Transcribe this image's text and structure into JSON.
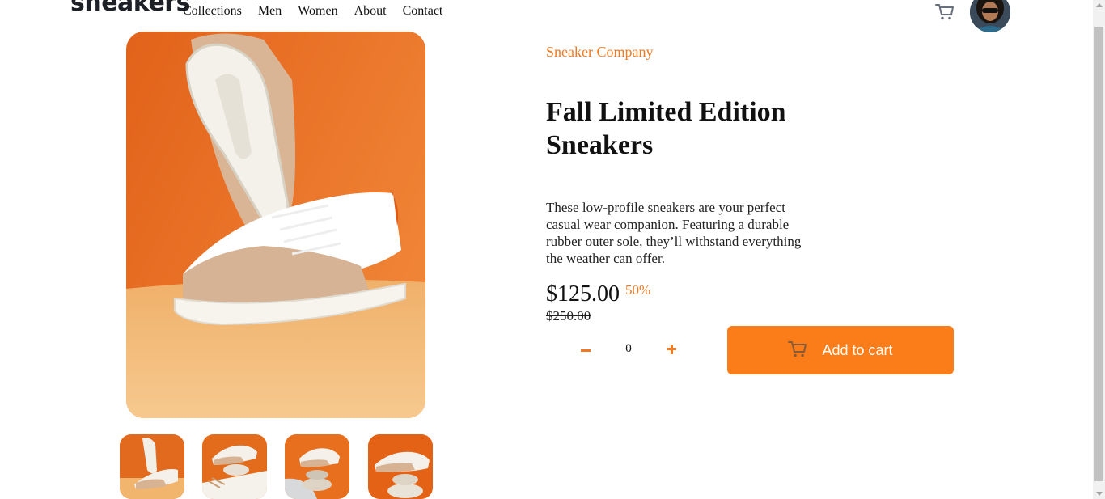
{
  "header": {
    "logo": "sneakers",
    "nav": [
      "Collections",
      "Men",
      "Women",
      "About",
      "Contact"
    ],
    "cart_icon": "cart-icon",
    "avatar_icon": "avatar"
  },
  "product": {
    "company": "Sneaker Company",
    "title": "Fall Limited Edition Sneakers",
    "description": "These low-profile sneakers are your perfect casual wear companion. Featuring a durable rubber outer sole, they’ll withstand everything the weather can offer.",
    "price": "$125.00",
    "discount": "50%",
    "old_price": "$250.00",
    "quantity": "0",
    "add_to_cart": "Add to cart"
  },
  "gallery": {
    "thumbnails": [
      "thumbnail-1",
      "thumbnail-2",
      "thumbnail-3",
      "thumbnail-4"
    ]
  },
  "colors": {
    "accent": "#f07a24",
    "button": "#fb7d1a",
    "text": "#111111"
  }
}
